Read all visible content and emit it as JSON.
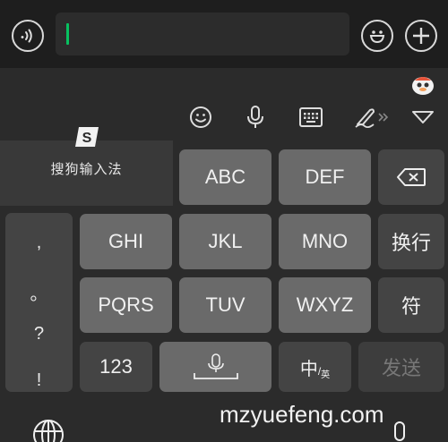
{
  "chat_bar": {
    "voice_icon": "voice-icon",
    "emoji_icon": "emoji-icon",
    "add_icon": "add-icon"
  },
  "toolbar": {
    "icons": [
      "smile-icon",
      "mic-icon",
      "keyboard-icon",
      "handwriting-icon",
      "chevron-down-icon"
    ]
  },
  "brand": {
    "name": "搜狗输入法"
  },
  "keys": {
    "row1": [
      "ABC",
      "DEF"
    ],
    "row2": [
      "GHI",
      "JKL",
      "MNO"
    ],
    "row3": [
      "PQRS",
      "TUV",
      "WXYZ"
    ],
    "switch_line": "换行",
    "symbol": "符",
    "num": "123",
    "lang_main": "中",
    "lang_sub": "英",
    "send": "发送"
  },
  "punctuation": [
    ",",
    "。",
    "?",
    "!"
  ],
  "watermark": "mzyuefeng.com",
  "colors": {
    "cursor": "#07c160",
    "key": "#6a6a6a",
    "dark_key": "#444444"
  }
}
